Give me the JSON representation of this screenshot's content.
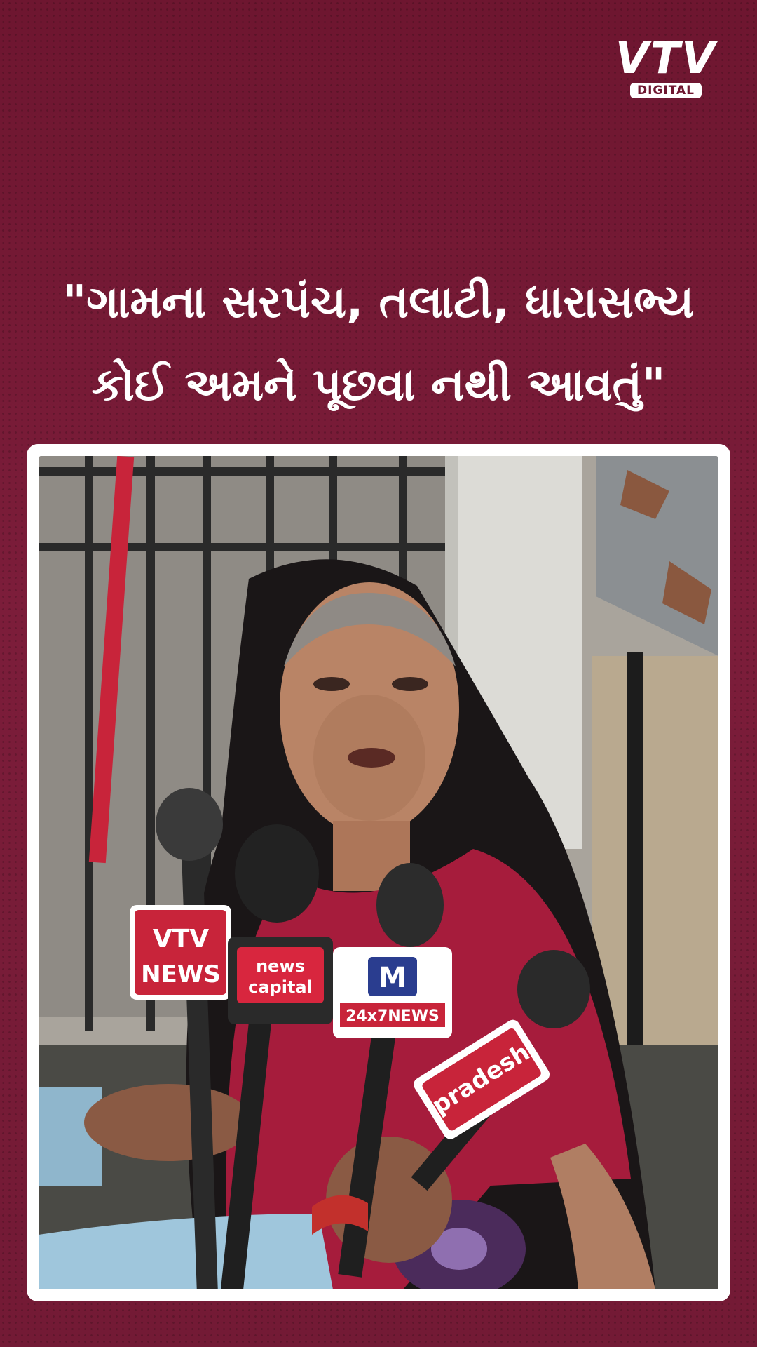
{
  "brand": {
    "logo_text": "VTV",
    "logo_subtext": "DIGITAL"
  },
  "headline": {
    "line1": "\"ગામના સરપંચ, તલાટી, ધારાસભ્ય",
    "line2": "કોઈ અમને પૂછવા નથી આવતું\""
  },
  "photo": {
    "mic_labels": {
      "vtv_line1": "VTV",
      "vtv_line2": "NEWS",
      "capital_line1": "news",
      "capital_line2": "capital",
      "mantavya_badge": "M",
      "mantavya_line": "24x7NEWS",
      "pradesh": "pradesh"
    },
    "colors": {
      "background_top": "#6e1630",
      "background_bottom": "#731a35",
      "saree": "#a61c3c",
      "headscarf": "#1a1617"
    }
  }
}
